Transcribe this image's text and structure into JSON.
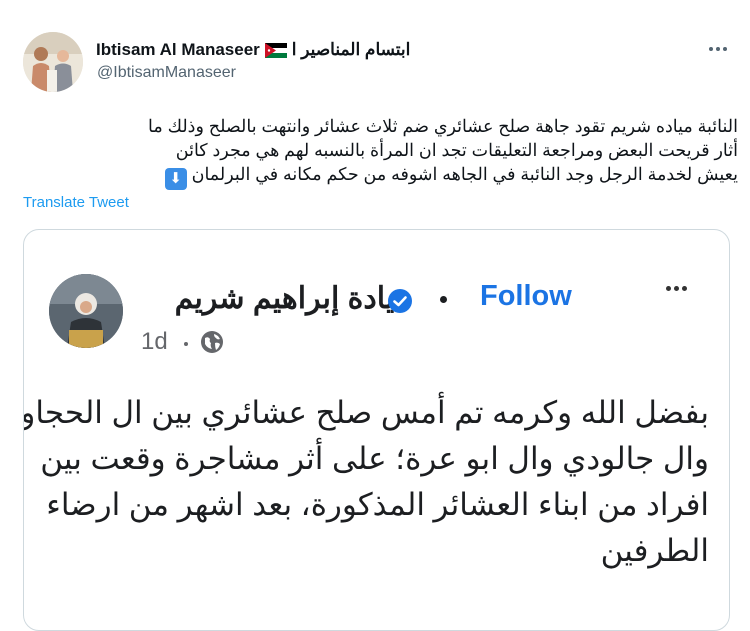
{
  "author": {
    "name_en": "Ibtisam Al Manaseer",
    "name_ar": "ابتسام المناصير ا",
    "handle": "@IbtisamManaseer",
    "flag_icon": "jordan-flag-icon"
  },
  "tweet": {
    "lines": [
      "النائبة مياده شريم تقود جاهة صلح عشائري ضم ثلاث عشائر وانتهت بالصلح وذلك ما",
      "أثار قريحت البعض ومراجعة التعليقات تجد ان المرأة بالنسبه لهم هي مجرد كائن",
      "يعيش لخدمة الرجل وجد النائبة في الجاهه اشوفه من حكم مكانه في البرلمان"
    ],
    "emoji": "⬇",
    "translate_label": "Translate Tweet"
  },
  "quoted_post": {
    "name": "ميادة إبراهيم شريم",
    "follow_label": "Follow",
    "time": "1d",
    "lines": [
      "بفضل الله وكرمه تم أمس صلح عشائري بين ال الحجاوي",
      "وال جالودي وال ابو عرة؛ على أثر مشاجرة وقعت بين",
      "افراد من ابناء العشائر المذكورة، بعد اشهر من ارضاء",
      "الطرفين"
    ]
  },
  "colors": {
    "link_blue": "#1d9bf0",
    "follow_blue": "#1b74e4",
    "secondary_text": "#536471"
  }
}
